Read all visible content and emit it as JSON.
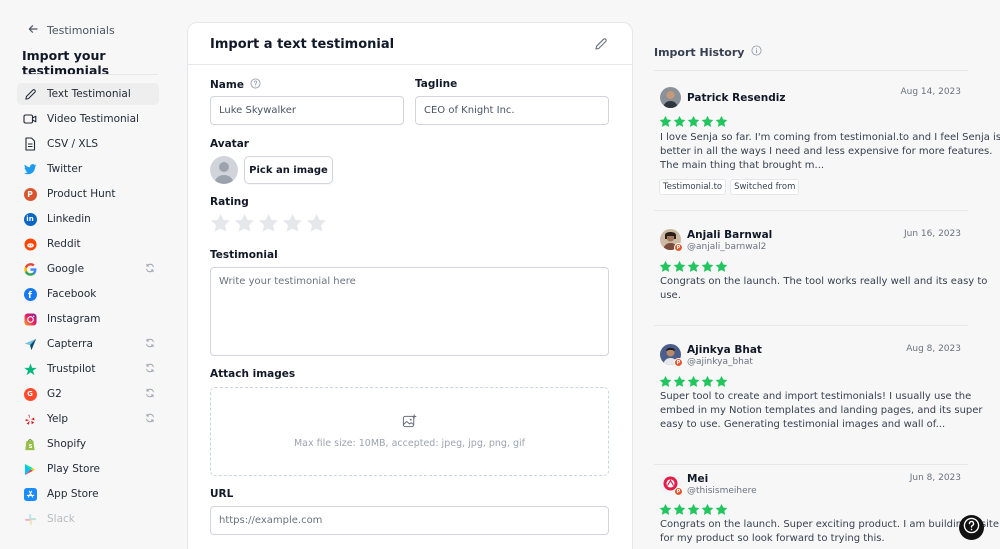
{
  "sidebar": {
    "back_label": "Testimonials",
    "title": "Import your testimonials",
    "items": [
      {
        "label": "Text Testimonial",
        "icon": "pencil-icon",
        "active": true
      },
      {
        "label": "Video Testimonial",
        "icon": "video-icon"
      },
      {
        "label": "CSV / XLS",
        "icon": "file-icon"
      },
      {
        "label": "Twitter",
        "icon": "twitter-icon"
      },
      {
        "label": "Product Hunt",
        "icon": "product-hunt-icon"
      },
      {
        "label": "Linkedin",
        "icon": "linkedin-icon"
      },
      {
        "label": "Reddit",
        "icon": "reddit-icon"
      },
      {
        "label": "Google",
        "icon": "google-icon",
        "sync": true
      },
      {
        "label": "Facebook",
        "icon": "facebook-icon"
      },
      {
        "label": "Instagram",
        "icon": "instagram-icon"
      },
      {
        "label": "Capterra",
        "icon": "capterra-icon",
        "sync": true
      },
      {
        "label": "Trustpilot",
        "icon": "trustpilot-icon",
        "sync": true
      },
      {
        "label": "G2",
        "icon": "g2-icon",
        "sync": true
      },
      {
        "label": "Yelp",
        "icon": "yelp-icon",
        "sync": true
      },
      {
        "label": "Shopify",
        "icon": "shopify-icon"
      },
      {
        "label": "Play Store",
        "icon": "play-store-icon"
      },
      {
        "label": "App Store",
        "icon": "app-store-icon"
      },
      {
        "label": "Slack",
        "icon": "slack-icon",
        "faded": true
      }
    ]
  },
  "form": {
    "title": "Import a text testimonial",
    "name_label": "Name",
    "name_value": "Luke Skywalker",
    "tagline_label": "Tagline",
    "tagline_value": "CEO of Knight Inc.",
    "avatar_label": "Avatar",
    "pick_image_label": "Pick an image",
    "rating_label": "Rating",
    "rating_value": 0,
    "rating_max": 5,
    "testimonial_label": "Testimonial",
    "testimonial_placeholder": "Write your testimonial here",
    "attach_label": "Attach images",
    "attach_hint": "Max file size: 10MB, accepted: jpeg, jpg, png, gif",
    "url_label": "URL",
    "url_placeholder": "https://example.com"
  },
  "history": {
    "title": "Import History",
    "items": [
      {
        "name": "Patrick Resendiz",
        "date": "Aug 14, 2023",
        "rating": 5,
        "lines": [
          "I love Senja so far. I'm coming from testimonial.to and I feel Senja is",
          "better in all the ways I need and less expensive for more features.",
          "The main thing that brought m..."
        ],
        "tags": [
          "Testimonial.to",
          "Switched from"
        ]
      },
      {
        "name": "Anjali Barnwal",
        "handle": "@anjali_barnwal2",
        "date": "Jun 16, 2023",
        "rating": 5,
        "lines": [
          "Congrats on the launch. The tool works really well and its easy to",
          "use."
        ]
      },
      {
        "name": "Ajinkya Bhat",
        "handle": "@ajinkya_bhat",
        "date": "Aug 8, 2023",
        "rating": 5,
        "lines": [
          "Super tool to create and import testimonials! I usually use the",
          "embed in my Notion templates and landing pages, and its super",
          "easy to use. Generating testimonial images and wall of..."
        ]
      },
      {
        "name": "Mei",
        "handle": "@thisismeihere",
        "date": "Jun 8, 2023",
        "rating": 5,
        "lines": [
          "Congrats on the launch. Super exciting product. I am building a site",
          "for my product so look forward to trying this."
        ]
      }
    ]
  },
  "colors": {
    "star_filled": "#22c55e",
    "star_empty": "#e5e7eb",
    "product_hunt_badge": "#e4572e"
  }
}
